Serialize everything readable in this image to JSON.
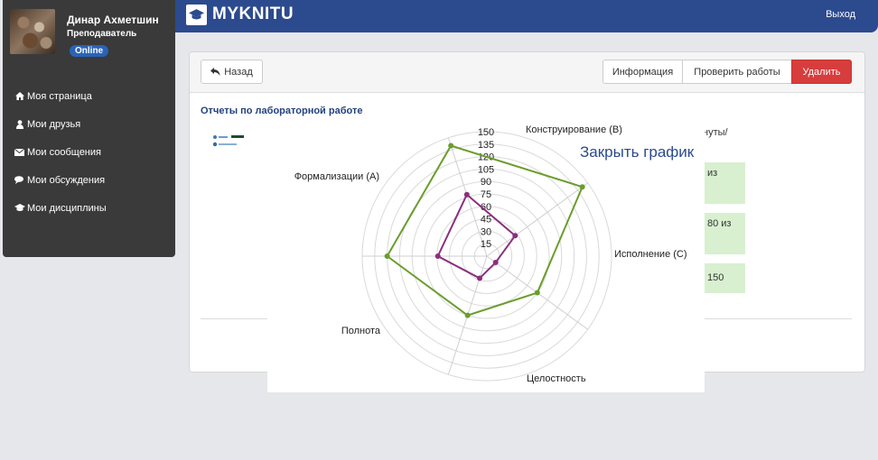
{
  "sidebar": {
    "user_name": "Динар Ахметшин",
    "user_role": "Преподаватель",
    "status": "Online",
    "items": [
      {
        "label": "Моя страница",
        "icon": "home-icon"
      },
      {
        "label": "Мои друзья",
        "icon": "user-icon"
      },
      {
        "label": "Мои сообщения",
        "icon": "envelope-icon"
      },
      {
        "label": "Мои обсуждения",
        "icon": "comments-icon"
      },
      {
        "label": "Мои дисциплины",
        "icon": "graduation-cap-icon"
      }
    ]
  },
  "header": {
    "brand": "MYKNITU",
    "logout": "Выход"
  },
  "panel": {
    "back_label": "Назад",
    "info_label": "Информация",
    "check_label": "Проверить работы",
    "delete_label": "Удалить",
    "section_title": "Отчеты по лабораторной работе",
    "col_header_partial": "нуты/",
    "cells": [
      "из",
      "80 из",
      "150"
    ]
  },
  "colors": {
    "topbar": "#2c4a8e",
    "sidebar": "#3a3a3a",
    "delete": "#d73d3d",
    "series_outer": "#6a9e2c",
    "series_inner": "#8a2f7e"
  },
  "chart": {
    "close_label": "Закрыть график"
  },
  "chart_data": {
    "type": "radar",
    "axes": [
      "Конструирование (B)",
      "Исполнение (C)",
      "Целостность",
      "Полнота",
      "Формализации (A)"
    ],
    "r_ticks": [
      15,
      30,
      45,
      60,
      75,
      90,
      105,
      120,
      135,
      150
    ],
    "rlim": [
      0,
      150
    ],
    "grid": true,
    "series": [
      {
        "color": "#6a9e2c",
        "values": [
          140,
          142,
          75,
          75,
          120
        ]
      },
      {
        "color": "#8a2f7e",
        "values": [
          78,
          42,
          13,
          28,
          59
        ]
      }
    ]
  }
}
